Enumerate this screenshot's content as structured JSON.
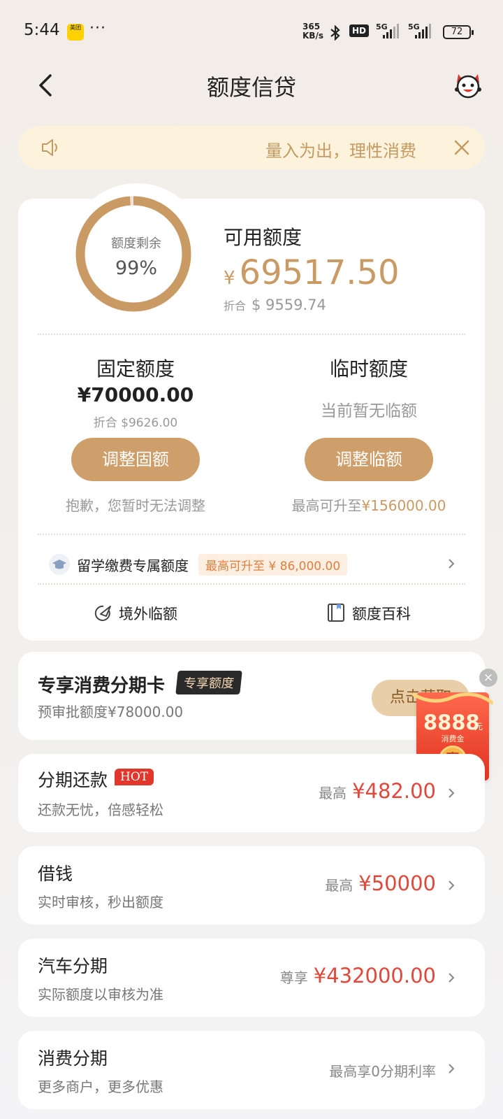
{
  "status_bar": {
    "time": "5:44",
    "app_badge": "美团",
    "overflow": "···",
    "net_speed_value": "365",
    "net_speed_unit": "KB/s",
    "hd": "HD",
    "sig1": "5G",
    "sig2": "5G",
    "battery": "72"
  },
  "header": {
    "title": "额度信贷"
  },
  "notice": {
    "text": "量入为出，理性消费"
  },
  "credit": {
    "ring_label": "额度剩余",
    "ring_percent": "99%",
    "ring_fraction": 0.99,
    "available_label": "可用额度",
    "available_currency": "¥",
    "available_amount": "69517.50",
    "conv_prefix": "折合",
    "conv_amount": "$ 9559.74",
    "fixed": {
      "title": "固定额度",
      "amount": "¥70000.00",
      "conv": "折合 $9626.00",
      "button": "调整固额",
      "note": "抱歉，您暂时无法调整"
    },
    "temp": {
      "title": "临时额度",
      "none": "当前暂无临额",
      "button": "调整临额",
      "note_prefix": "最高可升至",
      "note_amount": "¥156000.00"
    },
    "study": {
      "label": "留学缴费专属额度",
      "tag": "最高可升至 ¥ 86,000.00"
    },
    "links": {
      "overseas": "境外临额",
      "wiki": "额度百科"
    }
  },
  "install_card": {
    "title": "专享消费分期卡",
    "badge": "专享额度",
    "sub": "预审批额度¥78000.00",
    "button": "点击获取"
  },
  "float_coupon": {
    "close": "×",
    "amount": "8888",
    "unit": "元",
    "label": "消费金",
    "win": "赢"
  },
  "products": [
    {
      "title": "分期还款",
      "badge": "HOT",
      "sub": "还款无忧，倍感轻松",
      "pre": "最高",
      "amount": "¥482.00"
    },
    {
      "title": "借钱",
      "sub": "实时审核，秒出额度",
      "pre": "最高",
      "amount": "¥50000"
    },
    {
      "title": "汽车分期",
      "sub": "实际额度以审核为准",
      "pre": "尊享",
      "amount": "¥432000.00"
    },
    {
      "title": "消费分期",
      "sub": "更多商户，更多优惠",
      "plain": "最高享0分期利率"
    }
  ],
  "colors": {
    "accent": "#cf9f6b",
    "amount_red": "#e0483c",
    "notice_bg": "#fdf3dc"
  }
}
